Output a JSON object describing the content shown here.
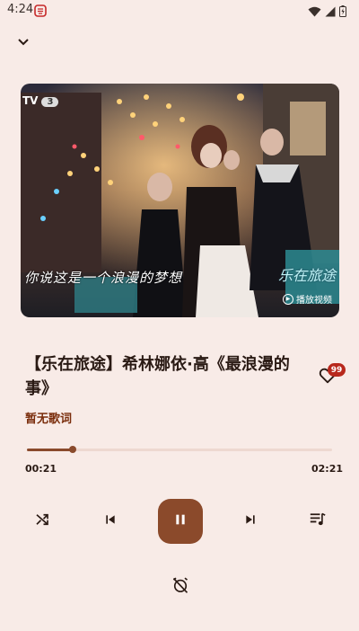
{
  "status_bar": {
    "time": "4:24"
  },
  "icons": {
    "collapse": "chevron-down-icon",
    "like": "heart-icon",
    "shuffle": "shuffle-icon",
    "previous": "skip-previous-icon",
    "play_pause": "pause-icon",
    "next": "skip-next-icon",
    "queue": "queue-music-icon",
    "timer": "alarm-off-icon"
  },
  "cover": {
    "logo": "TV",
    "logo_number": "3",
    "caption": "你说这是一个浪漫的梦想",
    "brand": "乐在旅途",
    "play_video_label": "播放视频"
  },
  "song": {
    "title": "【乐在旅途】希林娜依·高《最浪漫的事》",
    "lyric_status": "暂无歌词",
    "like_count": "99"
  },
  "playback": {
    "current_time": "00:21",
    "total_time": "02:21",
    "progress": 0.15
  },
  "colors": {
    "background": "#f8ebe7",
    "accent": "#8b4a2b",
    "badge": "#b8281c",
    "lyric_status": "#7a2d0c"
  }
}
